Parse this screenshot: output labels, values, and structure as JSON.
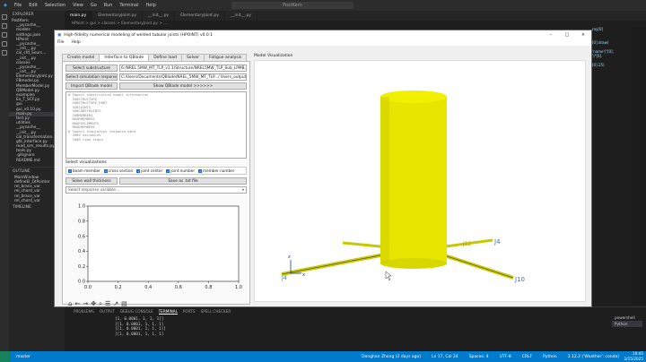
{
  "vscode": {
    "menu": [
      "File",
      "Edit",
      "Selection",
      "View",
      "Go",
      "Run",
      "Terminal",
      "Help"
    ],
    "search": "PostKern",
    "explorer_header": "EXPLORER",
    "files": [
      "PostKern",
      "__pycache__",
      "models",
      "settings.json",
      "HPoint",
      "__pycache__",
      "__init__.py",
      "cal_cfd_Sourc...",
      "__init__.py",
      "classes",
      "__pycache__",
      "__init__.py",
      "ElementaryJoint.py",
      "FBmodel.py",
      "MemberModel.py",
      "QBModel.py",
      "examples",
      "Ex_T_SCF.py",
      "gui",
      "gui_v0.10.py",
      "main.py",
      "test.py",
      "utilities",
      "__pycache__",
      "__init__.py",
      "cal_transformation.py",
      "gtk_interface.py",
      "read_sim_results.py",
      "tools.py",
      ".gitignore",
      "README.md"
    ],
    "outline_header": "OUTLINE",
    "outline_items": [
      "MainWindow",
      "defineEl_QtPointer",
      "rel_brace_var",
      "rel_chord_var",
      "rel_brace_var",
      "rel_chord_var"
    ],
    "timeline": "TIMELINE",
    "editor_tabs": [
      "main.py",
      "ElementaryJoint.py",
      "__init__.py",
      "ElementaryJoint.py",
      "__init__.py"
    ],
    "breadcrumb": "HPoint > gui > classes > ElementaryJoint.py > ...",
    "code_lines": [
      "ray[0]",
      "",
      "",
      "[0].draw(",
      "",
      "'name'(\"[0],",
      "')\"[0].",
      "",
      "[0].25)",
      "",
      "",
      "",
      ""
    ],
    "panel_tabs": [
      "PROBLEMS",
      "OUTPUT",
      "DEBUG CONSOLE",
      "TERMINAL",
      "PORTS",
      "SPELL CHECKER"
    ],
    "terminal_lines": [
      "[1, 0.0001, 1, 1, 1]]",
      "[[1, 0.0001, 1, 1, 1]",
      "[[1, 0.0001, 1, 1, 1]]",
      "[[1, 0.0001, 1, 1, 1]"
    ],
    "terminal_list": [
      "powershell",
      "Python"
    ],
    "status_left": "master",
    "status_right": [
      "Donghan Zhong (2 days ago)",
      "Ln 17, Col 24",
      "Spaces: 4",
      "UTF-8",
      "CRLF",
      "Python",
      "3.12.2 ('Weather': conda)"
    ],
    "clock_time": "10:45",
    "clock_date": "2/15/2025"
  },
  "app": {
    "title": "High-fidelity numerical modeling of welded tubular joints (HPOINT) v0.0.1",
    "menu": [
      "File",
      "Help"
    ],
    "tabs": [
      "Create model",
      "Interface to QBlade",
      "Define load",
      "Solver",
      "Fatigue analysis"
    ],
    "btn_substructure": "Select substructure",
    "fld_substructure": "6:/NREL 5MW_MT_TLP_v1.1/Structure/NREL5MW_TLP_Sub_LPMB.txt",
    "btn_simresp": "Select simulation response",
    "fld_simresp": "C:/Users/Documents/QBlade/NREL_5MW_MT_TLP.../ Users_output.txt",
    "btn_import": "Import QBlade model",
    "btn_show": "Show QBlade model >>>>>>",
    "info_lines": [
      "# Import substructure model information",
      "  SUBSTRUCTURE",
      "  SUBSTRUCTURE_ENDT",
      "  SUBJOINTS",
      "  SUBCONSTRAINTS",
      "  SUBMEMBERS",
      "  MOORMEMBERS",
      "  MOOREELEMENTS",
      "  MOORMEMBERS",
      "# Import simulation response data",
      "  3989 variables",
      "  1800 time steps."
    ],
    "vis_label": "Select visualizations",
    "checks": [
      "beam member",
      "cross section",
      "joint center",
      "joint number",
      "member number"
    ],
    "btn_solve": "Solve wall thickness",
    "btn_save": "Save as .txt file",
    "select_placeholder": "Select response variable...",
    "mv_label": "Model Visualization",
    "axis_label_y": "z",
    "axis_label_x": "x",
    "joint_labels": [
      "J4",
      "J10",
      "J12",
      "J4"
    ],
    "colors": {
      "cylinder": "#e6e600",
      "brace_line": "#c8c800",
      "accent": "#2a6ad8",
      "label": "#4a6fa5"
    }
  },
  "chart_data": {
    "type": "line",
    "title": "",
    "xlabel": "",
    "ylabel": "",
    "xlim": [
      0.0,
      1.0
    ],
    "ylim": [
      0.0,
      1.0
    ],
    "xticks": [
      "0.0",
      "0.2",
      "0.4",
      "0.6",
      "0.8",
      "1.0"
    ],
    "yticks": [
      "0.0",
      "0.2",
      "0.4",
      "0.6",
      "0.8",
      "1.0"
    ],
    "series": []
  },
  "toolbar_icons": [
    "home-icon",
    "back-icon",
    "forward-icon",
    "pan-icon",
    "zoom-icon",
    "configure-icon",
    "edit-curve-icon",
    "save-icon"
  ]
}
